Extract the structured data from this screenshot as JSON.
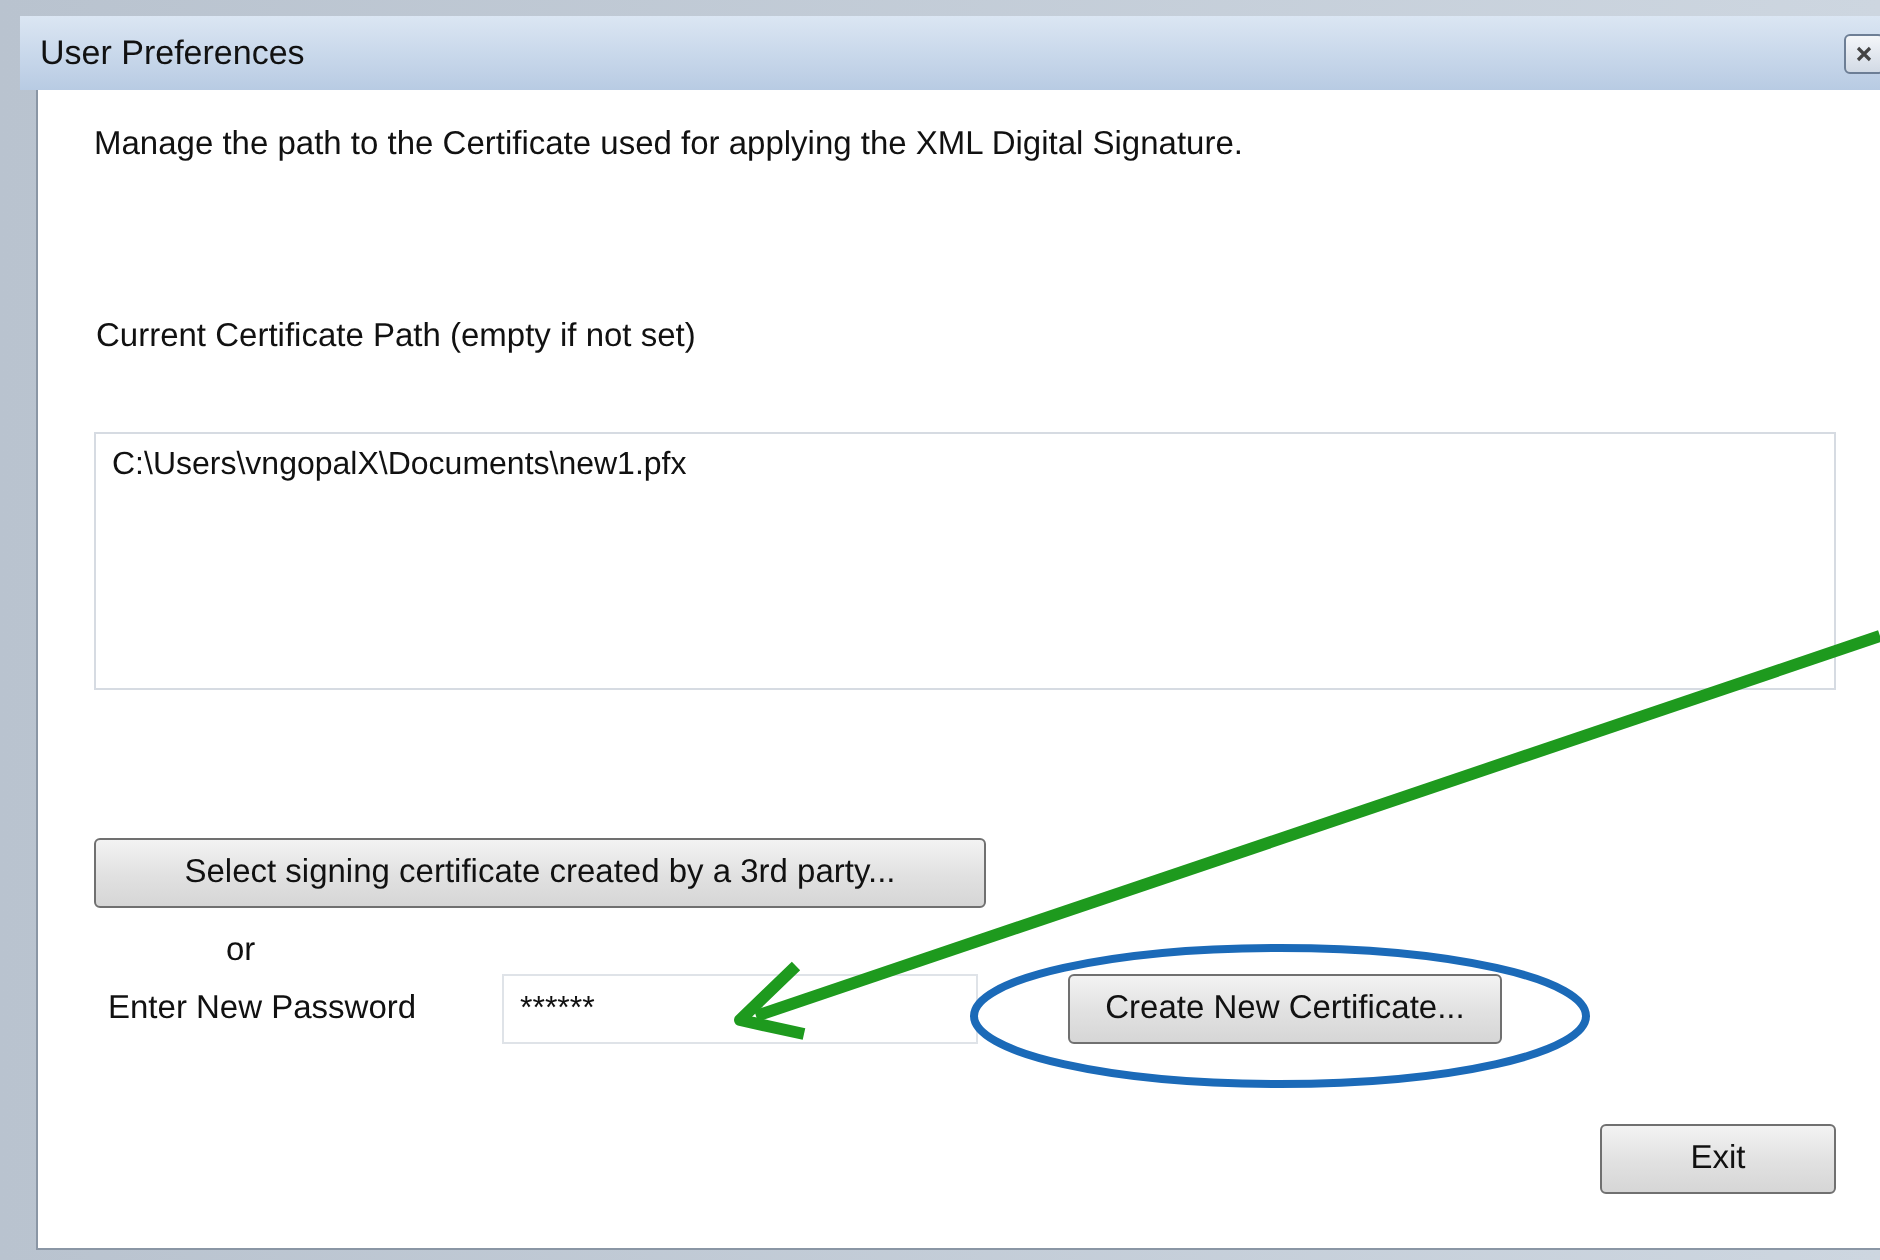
{
  "window": {
    "title": "User Preferences"
  },
  "description": "Manage the path to the Certificate used for applying the XML Digital Signature.",
  "path_label": "Current Certificate Path (empty if not set)",
  "path_value": "C:\\Users\\vngopalX\\Documents\\new1.pfx",
  "select_button": "Select signing certificate created by a 3rd party...",
  "or_text": "or",
  "password": {
    "label": "Enter New Password",
    "value": "******"
  },
  "create_button": "Create New Certificate...",
  "exit_button": "Exit"
}
